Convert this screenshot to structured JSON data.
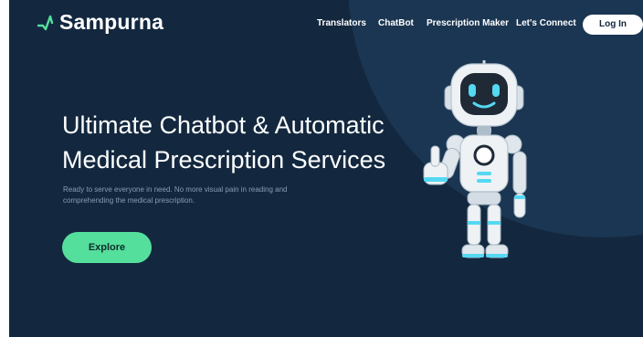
{
  "brand": {
    "name": "Sampurna",
    "accent": "#55df9c",
    "background": "#13283f"
  },
  "nav": {
    "items": [
      "Translators",
      "ChatBot",
      "Prescription Maker",
      "Let's Connect"
    ],
    "login_label": "Log In"
  },
  "hero": {
    "headline_line1": "Ultimate Chatbot & Automatic",
    "headline_line2": "Medical Prescription Services",
    "subtitle_line1": "Ready to serve everyone in need. No more visual pain in reading and",
    "subtitle_line2": "comprehending the medical prescription.",
    "cta_label": "Explore"
  },
  "illustration": {
    "icon": "robot-thumbs-up-icon"
  }
}
